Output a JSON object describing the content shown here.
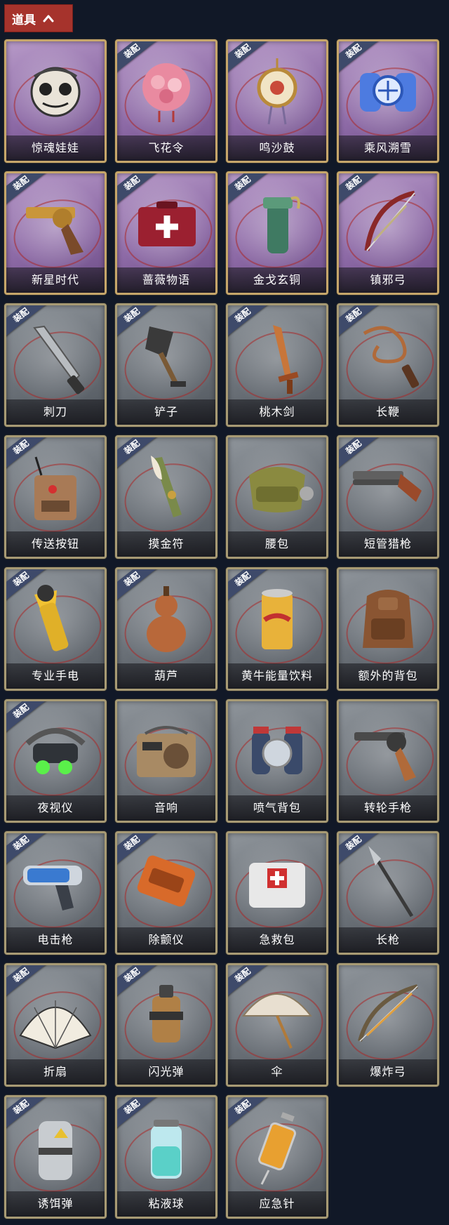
{
  "header": {
    "title": "道具"
  },
  "badge_text": "装配",
  "colors": {
    "background": "#111827",
    "header_tab": "#a6332c",
    "badge": "#3e4a6a",
    "frame_rare": "#c6a66a",
    "frame_common": "#a79a74"
  },
  "items": [
    {
      "label": "惊魂娃娃",
      "rarity": "purple",
      "equipped": false,
      "icon": "skull-doll-icon"
    },
    {
      "label": "飞花令",
      "rarity": "purple",
      "equipped": true,
      "icon": "flower-lantern-icon"
    },
    {
      "label": "鸣沙鼓",
      "rarity": "purple",
      "equipped": true,
      "icon": "sand-drum-icon"
    },
    {
      "label": "乘风溯雪",
      "rarity": "purple",
      "equipped": true,
      "icon": "snow-jetpack-icon"
    },
    {
      "label": "新星时代",
      "rarity": "purple",
      "equipped": true,
      "icon": "golden-revolver-icon"
    },
    {
      "label": "蔷薇物语",
      "rarity": "purple",
      "equipped": true,
      "icon": "rose-medkit-icon"
    },
    {
      "label": "金戈玄铜",
      "rarity": "purple",
      "equipped": true,
      "icon": "bronze-grenade-icon"
    },
    {
      "label": "镇邪弓",
      "rarity": "purple",
      "equipped": true,
      "icon": "exorcism-bow-icon"
    },
    {
      "label": "刺刀",
      "rarity": "gray",
      "equipped": true,
      "icon": "bayonet-icon"
    },
    {
      "label": "铲子",
      "rarity": "gray",
      "equipped": true,
      "icon": "shovel-icon"
    },
    {
      "label": "桃木剑",
      "rarity": "gray",
      "equipped": true,
      "icon": "wooden-sword-icon"
    },
    {
      "label": "长鞭",
      "rarity": "gray",
      "equipped": true,
      "icon": "whip-icon"
    },
    {
      "label": "传送按钮",
      "rarity": "gray",
      "equipped": true,
      "icon": "teleport-button-icon"
    },
    {
      "label": "摸金符",
      "rarity": "gray",
      "equipped": true,
      "icon": "talisman-icon"
    },
    {
      "label": "腰包",
      "rarity": "gray",
      "equipped": false,
      "icon": "waist-bag-icon"
    },
    {
      "label": "短管猎枪",
      "rarity": "gray",
      "equipped": true,
      "icon": "sawed-off-shotgun-icon"
    },
    {
      "label": "专业手电",
      "rarity": "gray",
      "equipped": true,
      "icon": "flashlight-icon"
    },
    {
      "label": "葫芦",
      "rarity": "gray",
      "equipped": true,
      "icon": "gourd-icon"
    },
    {
      "label": "黄牛能量饮料",
      "rarity": "gray",
      "equipped": true,
      "icon": "energy-drink-icon"
    },
    {
      "label": "额外的背包",
      "rarity": "gray",
      "equipped": false,
      "icon": "backpack-icon"
    },
    {
      "label": "夜视仪",
      "rarity": "gray",
      "equipped": true,
      "icon": "night-vision-icon"
    },
    {
      "label": "音响",
      "rarity": "gray",
      "equipped": false,
      "icon": "radio-speaker-icon"
    },
    {
      "label": "喷气背包",
      "rarity": "gray",
      "equipped": false,
      "icon": "jetpack-icon"
    },
    {
      "label": "转轮手枪",
      "rarity": "gray",
      "equipped": false,
      "icon": "revolver-icon"
    },
    {
      "label": "电击枪",
      "rarity": "gray",
      "equipped": true,
      "icon": "shock-gun-icon"
    },
    {
      "label": "除颤仪",
      "rarity": "gray",
      "equipped": true,
      "icon": "defibrillator-icon"
    },
    {
      "label": "急救包",
      "rarity": "gray",
      "equipped": false,
      "icon": "first-aid-kit-icon"
    },
    {
      "label": "长枪",
      "rarity": "gray",
      "equipped": true,
      "icon": "spear-icon"
    },
    {
      "label": "折扇",
      "rarity": "gray",
      "equipped": true,
      "icon": "folding-fan-icon"
    },
    {
      "label": "闪光弹",
      "rarity": "gray",
      "equipped": true,
      "icon": "flashbang-icon"
    },
    {
      "label": "伞",
      "rarity": "gray",
      "equipped": true,
      "icon": "umbrella-icon"
    },
    {
      "label": "爆炸弓",
      "rarity": "gray",
      "equipped": false,
      "icon": "explosive-bow-icon"
    },
    {
      "label": "诱饵弹",
      "rarity": "gray",
      "equipped": true,
      "icon": "decoy-grenade-icon"
    },
    {
      "label": "粘液球",
      "rarity": "gray",
      "equipped": true,
      "icon": "slime-ball-icon"
    },
    {
      "label": "应急针",
      "rarity": "gray",
      "equipped": true,
      "icon": "syringe-icon"
    }
  ]
}
